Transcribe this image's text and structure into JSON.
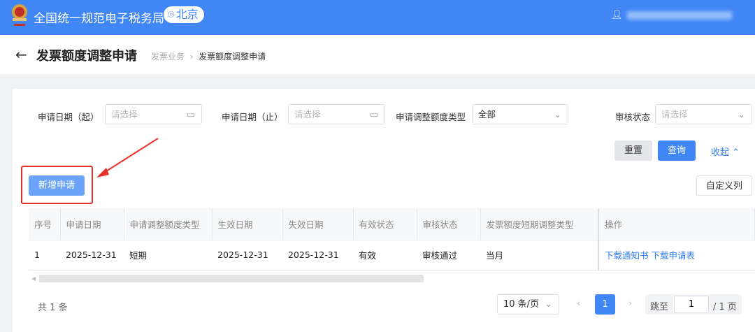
{
  "header": {
    "site_name": "全国统一规范电子税务局",
    "location": "北京",
    "user_icon": "user-icon"
  },
  "titlebar": {
    "back_icon": "arrow-left-icon",
    "title": "发票额度调整申请",
    "breadcrumb": [
      "发票业务",
      "发票额度调整申请"
    ]
  },
  "filters": [
    {
      "label": "申请日期（起）",
      "placeholder": "请选择",
      "icon": "calendar-icon"
    },
    {
      "label": "申请日期（止）",
      "placeholder": "请选择",
      "icon": "calendar-icon"
    },
    {
      "label": "申请调整额度类型",
      "value": "全部",
      "icon": "chevron-down-icon"
    },
    {
      "label": "审核状态",
      "placeholder": "请选择",
      "icon": "chevron-down-icon"
    }
  ],
  "actions": {
    "reset": "重置",
    "query": "查询",
    "collapse": "收起",
    "add": "新增申请",
    "custom_columns": "自定义列"
  },
  "table": {
    "columns": [
      "序号",
      "申请日期",
      "申请调整额度类型",
      "生效日期",
      "失效日期",
      "有效状态",
      "审核状态",
      "发票额度短期调整类型",
      "操作"
    ],
    "rows": [
      {
        "cells": [
          "1",
          "2025-12-31",
          "短期",
          "2025-12-31",
          "2025-12-31",
          "有效",
          "审核通过",
          "当月"
        ],
        "links": [
          "下载通知书",
          "下载申请表"
        ]
      }
    ]
  },
  "pagination": {
    "total": "共 1 条",
    "page_size": "10 条/页",
    "current": "1",
    "jump_label": "跳至",
    "jump_value": "1",
    "total_pages": "/ 1 页"
  },
  "colors": {
    "header": "#4086f4",
    "primary": "#4086f4",
    "annotation": "#e8302a"
  }
}
